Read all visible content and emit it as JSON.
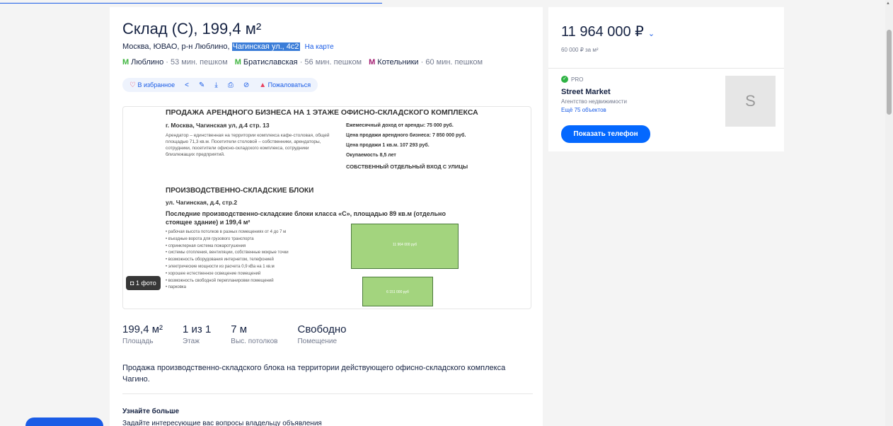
{
  "listing": {
    "title": "Склад (С), 199,4 м²",
    "address_prefix": "Москва, ЮВАО, р-н Люблино,",
    "address_highlight": "Чагинская ул., 4с2",
    "map_link": "На карте",
    "metro": [
      {
        "name": "Люблино",
        "walk": "· 53 мин. пешком",
        "color": "#3eb53e"
      },
      {
        "name": "Братиславская",
        "walk": "· 56 мин. пешком",
        "color": "#3eb53e"
      },
      {
        "name": "Котельники",
        "walk": "· 60 мин. пешком",
        "color": "#a1196f"
      }
    ],
    "actions": {
      "favorite": "В избранное",
      "complain": "Пожаловаться"
    },
    "photo": {
      "heading": "ПРОДАЖА АРЕНДНОГО БИЗНЕСА НА 1 ЭТАЖЕ ОФИСНО-СКЛАДСКОГО КОМПЛЕКСА",
      "addr1": "г. Москва, Чагинская ул, д.4 стр. 13",
      "left_text": "Арендатор – единственная на территории комплекса кафе-столовая, общей площадью 71,3 кв.м. Посетители столовой – собственники, арендаторы, сотрудники, посетители офисно-складского комплекса, сотрудники близлежащих предприятий.",
      "r1": "Ежемесячный доход от аренды: 75 000 руб.",
      "r2": "Цена продажи арендного бизнеса: 7 850 000 руб.",
      "r3": "Цена продажи 1 кв.м. 107 293 руб.",
      "r4": "Окупаемость 8,5 лет",
      "r5": "СОБСТВЕННЫЙ ОТДЕЛЬНЫЙ ВХОД С УЛИЦЫ",
      "h2": "ПРОИЗВОДСТВЕННО-СКЛАДСКИЕ БЛОКИ",
      "addr2": "ул. Чагинская, д.4, стр.2",
      "h3": "Последние производственно-складские блоки класса «С», площадью 89 кв.м (отдельно стоящее здание) и 199,4 м²",
      "bullets": "• рабочая высота потолков в разных помещениях от 4 до 7 м\n• въездные ворота для грузового транспорта\n• спринклерная система пожаротушения\n• системы отопления, вентиляции, собственные мокрые точки\n• возможность оборудования интернетом, телефонией\n• электрические мощности из расчета 0,9 кВа на 1 кв.м\n• хорошее естественное освещение помещений\n• возможность свободной перепланировки помещений\n• парковка",
      "plan1": "11 964 000 руб",
      "plan2": "6 151 000 руб",
      "badge": "1 фото"
    },
    "facts": [
      {
        "value": "199,4 м²",
        "label": "Площадь"
      },
      {
        "value": "1 из 1",
        "label": "Этаж"
      },
      {
        "value": "7 м",
        "label": "Выс. потолков"
      },
      {
        "value": "Свободно",
        "label": "Помещение"
      }
    ],
    "description": "Продажа производственно-складского блока на территории действующего офисно-складского комплекса Чагино.",
    "learn_more": "Узнайте больше",
    "learn_more_sub": "Задайте интересующие вас вопросы владельцу объявления"
  },
  "sidebar": {
    "price": "11 964 000 ₽",
    "price_per_m": "60 000 ₽ за м²",
    "pro_label": "PRO",
    "agency_name": "Street Market",
    "agency_type": "Агентство недвижимости",
    "agency_more": "Ещё 75 объектов",
    "logo_letter": "S",
    "phone_button": "Показать телефон"
  },
  "colors": {
    "accent": "#1a5ce6",
    "button": "#0468ff"
  }
}
